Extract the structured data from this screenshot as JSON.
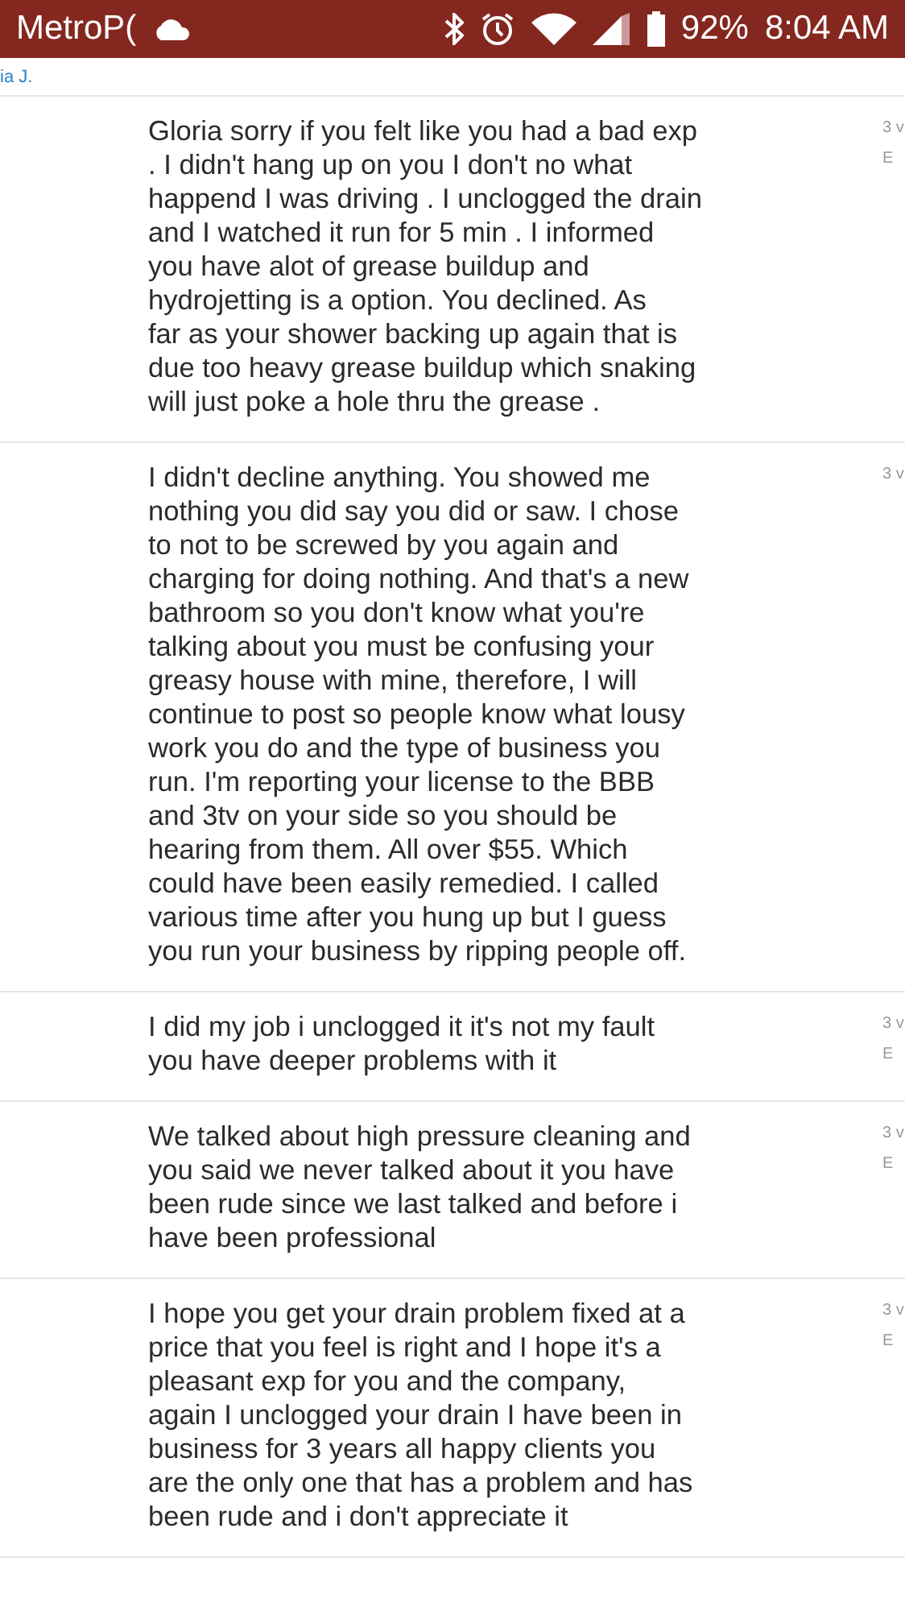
{
  "status_bar": {
    "carrier": "MetroP(",
    "battery": "92%",
    "time": "8:04 AM"
  },
  "header": {
    "name": "ia J."
  },
  "messages": [
    {
      "text": "Gloria sorry if you felt like you had a bad exp\n. I didn't hang up on you I don't no what\nhappend I was driving . I unclogged the drain\nand I watched it run for 5 min . I informed\nyou have alot of grease buildup and\nhydrojetting is a option.  You declined.  As\nfar as your shower backing up again that is\ndue too heavy grease buildup which snaking\nwill just poke  a hole thru the grease .",
      "meta": [
        "3 v",
        "E"
      ]
    },
    {
      "text": "I didn't decline anything. You showed me\nnothing you did say you did or saw. I chose\nto not to be screwed by you again and\ncharging for doing nothing. And that's a new\nbathroom so you don't know what you're\ntalking about you must be confusing your\ngreasy house with mine, therefore, I will\ncontinue to post so people know what lousy\nwork you do and the type of business you\nrun. I'm reporting your license to the BBB\nand 3tv on your side so you should be\nhearing from them. All over $55. Which\ncould have been easily remedied. I called\nvarious time after you hung up but I guess\nyou run your business by ripping people off.",
      "meta": [
        "3 v"
      ]
    },
    {
      "text": "I did my job i unclogged it it's not my fault\nyou have deeper problems with it",
      "meta": [
        "3 v",
        "E"
      ]
    },
    {
      "text": "We talked about high pressure cleaning and\nyou said we never talked about it you have\nbeen rude since we last talked and before i\nhave been professional",
      "meta": [
        "3 v",
        "E"
      ]
    },
    {
      "text": "I hope you get your drain problem fixed at a\nprice that you feel is right and I hope it's a\npleasant exp for you and the company,\n again I unclogged your drain I have been in\nbusiness for 3 years all happy clients you\nare the only one that has a problem and has\nbeen rude and i don't appreciate it",
      "meta": [
        "3 v",
        "E"
      ]
    }
  ]
}
